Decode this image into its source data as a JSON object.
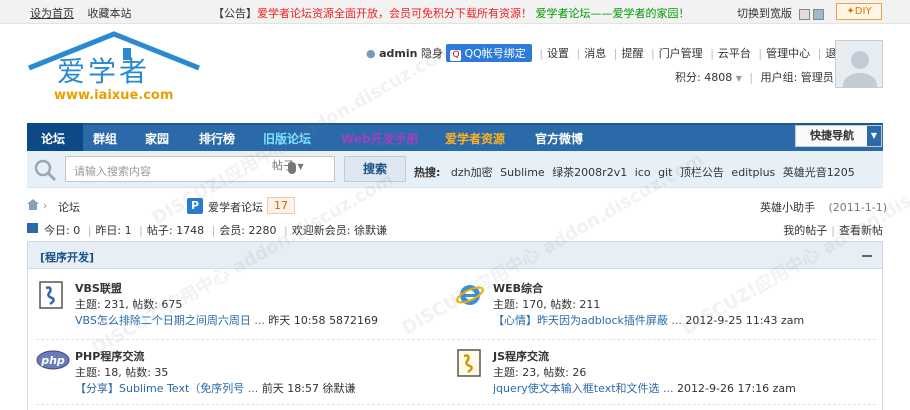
{
  "topbar": {
    "set_home": "设为首页",
    "favorite": "收藏本站",
    "notice_prefix": "【公告】",
    "notice_red": "爱学者论坛资源全面开放，会员可免积分下载所有资源！",
    "notice_green": "爱学者论坛——爱学者的家园！",
    "wide_label": "切换到宽版",
    "diy_label": "✦DIY"
  },
  "logo": {
    "text": "爱学者",
    "url_text": "www.iaixue.com"
  },
  "user": {
    "name": "admin",
    "stealth": "隐身",
    "qq_bind": "QQ帐号绑定",
    "links": [
      "设置",
      "消息",
      "提醒",
      "门户管理",
      "云平台",
      "管理中心",
      "退出"
    ],
    "points": "积分: 4808",
    "group": "用户组: 管理员"
  },
  "nav": {
    "items": [
      {
        "label": "论坛",
        "color": "#ffffff"
      },
      {
        "label": "群组",
        "color": "#ffffff"
      },
      {
        "label": "家园",
        "color": "#ffffff"
      },
      {
        "label": "排行榜",
        "color": "#ffffff"
      },
      {
        "label": "旧版论坛",
        "color": "#7fe3ff"
      },
      {
        "label": "Web开发手册",
        "color": "#a040c0"
      },
      {
        "label": "爱学者资源",
        "color": "#ffb020"
      },
      {
        "label": "官方微博",
        "color": "#ffffff"
      }
    ],
    "quick_nav": "快捷导航"
  },
  "search": {
    "placeholder": "请输入搜索内容",
    "select": "帖子",
    "button": "搜索",
    "hot_label": "热搜:",
    "hot_items": [
      "dzh加密",
      "Sublime",
      "绿茶2008r2v1",
      "ico",
      "git",
      "顶栏公告",
      "editplus",
      "英雄光音1205"
    ]
  },
  "breadcrumb": {
    "sep": "›",
    "root": "论坛",
    "forum_name": "爱学者论坛",
    "forum_count": "17",
    "helper": "英雄小助手",
    "helper_date": "(2011-1-1)"
  },
  "stats": {
    "today_label": "今日:",
    "today": "0",
    "yesterday_label": "昨日:",
    "yesterday": "1",
    "posts_label": "帖子:",
    "posts": "1748",
    "members_label": "会员:",
    "members": "2280",
    "welcome": "欢迎新会员:",
    "new_member": "徐默谦",
    "my_posts": "我的帖子",
    "view_new": "查看新帖"
  },
  "section": {
    "title": "[程序开发]",
    "forums": [
      {
        "name": "VBS联盟",
        "meta": "主题: 231, 帖数: 675",
        "last_title": "VBS怎么排除二个日期之间周六周日 ...",
        "last_time": "昨天 10:58",
        "last_user": "5872169",
        "icon": "script-icon"
      },
      {
        "name": "WEB综合",
        "meta": "主题: 170, 帖数: 211",
        "last_title": "【心情】昨天因为adblock插件屏蔽 ...",
        "last_time": "2012-9-25 11:43",
        "last_user": "zam",
        "icon": "ie-icon"
      },
      {
        "name": "PHP程序交流",
        "meta": "主题: 18, 帖数: 35",
        "last_title": "【分享】Sublime Text（免序列号 ...",
        "last_time": "前天 18:57",
        "last_user": "徐默谦",
        "icon": "php-icon"
      },
      {
        "name": "JS程序交流",
        "meta": "主题: 23, 帖数: 26",
        "last_title": "jquery使文本输入框text和文件选 ...",
        "last_time": "2012-9-26 17:16",
        "last_user": "zam",
        "icon": "js-script-icon"
      }
    ]
  },
  "watermark": "DISCUZ!应用中心 addon.discuz.com"
}
